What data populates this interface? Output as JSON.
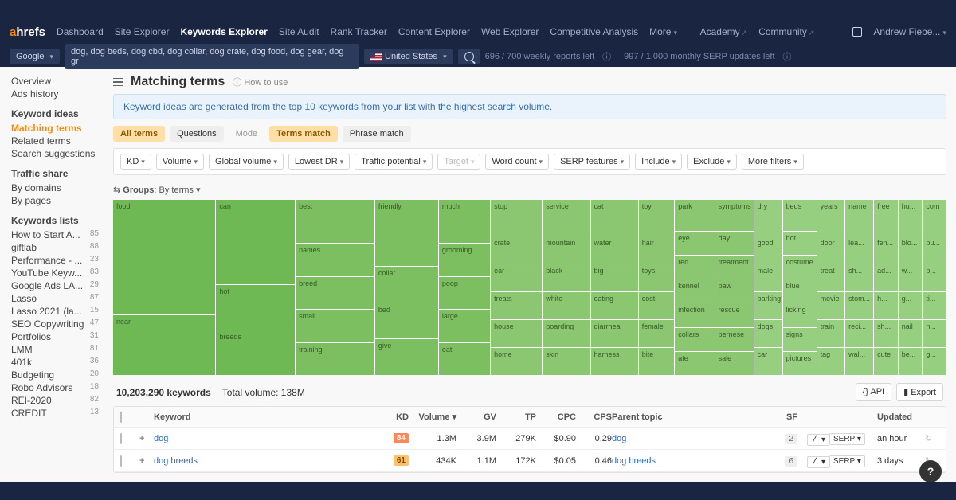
{
  "nav": {
    "logo_a": "a",
    "logo_rest": "hrefs",
    "items": [
      "Dashboard",
      "Site Explorer",
      "Keywords Explorer",
      "Site Audit",
      "Rank Tracker",
      "Content Explorer",
      "Web Explorer",
      "Competitive Analysis",
      "More"
    ],
    "active_index": 2,
    "academy": "Academy",
    "community": "Community",
    "user": "Andrew Fiebe..."
  },
  "subnav": {
    "search_engine": "Google",
    "keywords_input": "dog, dog beds, dog cbd, dog collar, dog crate, dog food, dog gear, dog gr",
    "country": "United States",
    "quota1": "696 / 700 weekly reports left",
    "quota2": "997 / 1,000 monthly SERP updates left"
  },
  "sidebar": {
    "plain": [
      "Overview",
      "Ads history"
    ],
    "ideas_hd": "Keyword ideas",
    "ideas": [
      "Matching terms",
      "Related terms",
      "Search suggestions"
    ],
    "traffic_hd": "Traffic share",
    "traffic": [
      "By domains",
      "By pages"
    ],
    "lists_hd": "Keywords lists",
    "lists": [
      {
        "n": "How to Start A...",
        "c": "85"
      },
      {
        "n": "giftlab",
        "c": "88"
      },
      {
        "n": "Performance - ...",
        "c": "23"
      },
      {
        "n": "YouTube Keyw...",
        "c": "83"
      },
      {
        "n": "Google Ads LA...",
        "c": "29"
      },
      {
        "n": "Lasso",
        "c": "87"
      },
      {
        "n": "Lasso 2021 (la...",
        "c": "15"
      },
      {
        "n": "SEO Copywriting",
        "c": "47"
      },
      {
        "n": "Portfolios",
        "c": "31"
      },
      {
        "n": "LMM",
        "c": "81"
      },
      {
        "n": "401k",
        "c": "36"
      },
      {
        "n": "Budgeting",
        "c": "20"
      },
      {
        "n": "Robo Advisors",
        "c": "18"
      },
      {
        "n": "REI-2020",
        "c": "82"
      },
      {
        "n": "CREDIT",
        "c": "13"
      }
    ]
  },
  "page": {
    "title": "Matching terms",
    "howto": "How to use",
    "banner": "Keyword ideas are generated from the top 10 keywords from your list with the highest search volume.",
    "tabs": {
      "all": "All terms",
      "q": "Questions",
      "mode": "Mode",
      "tm": "Terms match",
      "pm": "Phrase match"
    },
    "filters": [
      "KD",
      "Volume",
      "Global volume",
      "Lowest DR",
      "Traffic potential",
      "Target",
      "Word count",
      "SERP features",
      "Include",
      "Exclude",
      "More filters"
    ],
    "groups_lbl": "Groups",
    "groups_by": "By terms"
  },
  "treemap": {
    "c1": [
      "food",
      "near"
    ],
    "c2": [
      "can",
      "hot",
      "breeds"
    ],
    "c3": [
      "best",
      "names",
      "breed",
      "small",
      "training"
    ],
    "c4": [
      "friendly",
      "collar",
      "bed",
      "give"
    ],
    "c5": [
      "much",
      "grooming",
      "poop",
      "large",
      "eat"
    ],
    "c6": [
      "stop",
      "crate",
      "ear",
      "treats",
      "house",
      "home"
    ],
    "c7": [
      "service",
      "mountain",
      "black",
      "white",
      "boarding",
      "skin"
    ],
    "c8": [
      "cat",
      "water",
      "big",
      "eating",
      "diarrhea",
      "harness"
    ],
    "c9": [
      "toy",
      "hair",
      "toys",
      "cost",
      "female",
      "bite"
    ],
    "c10": [
      "park",
      "eye",
      "red",
      "kennel",
      "infection",
      "collars",
      "ate"
    ],
    "c11": [
      "symptoms",
      "day",
      "treatment",
      "paw",
      "rescue",
      "bernese",
      "sale"
    ],
    "c12": [
      "dry",
      "good",
      "male",
      "barking",
      "dogs",
      "car"
    ],
    "c13": [
      "beds",
      "hot...",
      "costume",
      "blue",
      "licking",
      "signs",
      "pictures"
    ],
    "c14": [
      "years",
      "door",
      "treat",
      "movie",
      "train",
      "tag"
    ],
    "c15": [
      "name",
      "lea...",
      "sh...",
      "stom...",
      "reci...",
      "wal..."
    ],
    "c16": [
      "free",
      "fen...",
      "ad...",
      "h...",
      "sh...",
      "cute"
    ],
    "c17": [
      "hu...",
      "blo...",
      "w...",
      "g...",
      "nail",
      "be..."
    ],
    "c18": [
      "com",
      "pu...",
      "p...",
      "ti...",
      "n...",
      "g..."
    ]
  },
  "summary": {
    "count": "10,203,290 keywords",
    "tv": "Total volume: 138M",
    "api": "API",
    "export": "Export"
  },
  "table": {
    "hd": {
      "kw": "Keyword",
      "kd": "KD",
      "vol": "Volume",
      "gv": "GV",
      "tp": "TP",
      "cpc": "CPC",
      "cps": "CPS",
      "pt": "Parent topic",
      "sf": "SF",
      "upd": "Updated"
    },
    "rows": [
      {
        "kw": "dog",
        "kd": "84",
        "kdc": "kd84",
        "vol": "1.3M",
        "gv": "3.9M",
        "tp": "279K",
        "cpc": "$0.90",
        "cps": "0.29",
        "pt": "dog",
        "sf": "2",
        "serp": "SERP",
        "upd": "an hour"
      },
      {
        "kw": "dog breeds",
        "kd": "61",
        "kdc": "kd61",
        "vol": "434K",
        "gv": "1.1M",
        "tp": "172K",
        "cpc": "$0.05",
        "cps": "0.46",
        "pt": "dog breeds",
        "sf": "6",
        "serp": "SERP",
        "upd": "3 days"
      }
    ]
  }
}
